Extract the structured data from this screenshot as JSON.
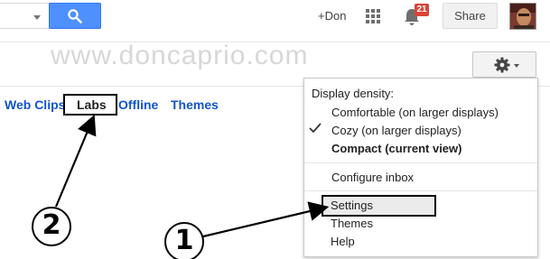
{
  "header": {
    "user_link": "+Don",
    "notification_count": "21",
    "share_label": "Share"
  },
  "watermark": "www.doncaprio.com",
  "tabs": [
    {
      "label": "Web Clips"
    },
    {
      "label": "Labs"
    },
    {
      "label": "Offline"
    },
    {
      "label": "Themes"
    }
  ],
  "menu": {
    "heading": "Display density:",
    "density_options": [
      {
        "label": "Comfortable (on larger displays)",
        "checked": false
      },
      {
        "label": "Cozy (on larger displays)",
        "checked": true
      },
      {
        "label": "Compact (current view)",
        "checked": false
      }
    ],
    "configure_inbox": "Configure inbox",
    "settings": "Settings",
    "themes": "Themes",
    "help": "Help"
  },
  "annotations": [
    {
      "label": "1"
    },
    {
      "label": "2"
    }
  ],
  "colors": {
    "accent": "#4d90fe",
    "link": "#1155cc",
    "badge": "#db4437"
  },
  "icons": [
    "dropdown-caret-icon",
    "search-icon",
    "apps-grid-icon",
    "bell-icon",
    "gear-icon",
    "checkmark-icon"
  ]
}
